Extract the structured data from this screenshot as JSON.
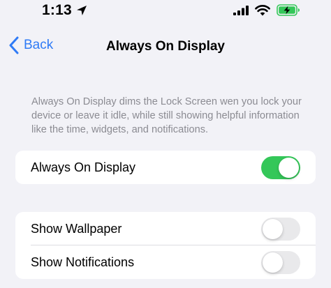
{
  "status_bar": {
    "time": "1:13",
    "icons": [
      "location-arrow-icon",
      "cellular-signal-icon",
      "wifi-icon",
      "battery-charging-icon"
    ],
    "battery_color": "#34c759"
  },
  "nav": {
    "back_label": "Back",
    "title": "Always On Display",
    "accent_color": "#2f7bf6"
  },
  "description": "Always On Display dims the Lock Screen wen you lock your device or leave it idle, while still showing helpful information like the time, widgets, and notifications.",
  "settings": {
    "always_on_display": {
      "label": "Always On Display",
      "enabled": true
    },
    "show_wallpaper": {
      "label": "Show Wallpaper",
      "enabled": false
    },
    "show_notifications": {
      "label": "Show Notifications",
      "enabled": false
    }
  },
  "colors": {
    "toggle_on": "#34c759",
    "toggle_off": "#e9e9eb",
    "background": "#f2f2f7"
  }
}
